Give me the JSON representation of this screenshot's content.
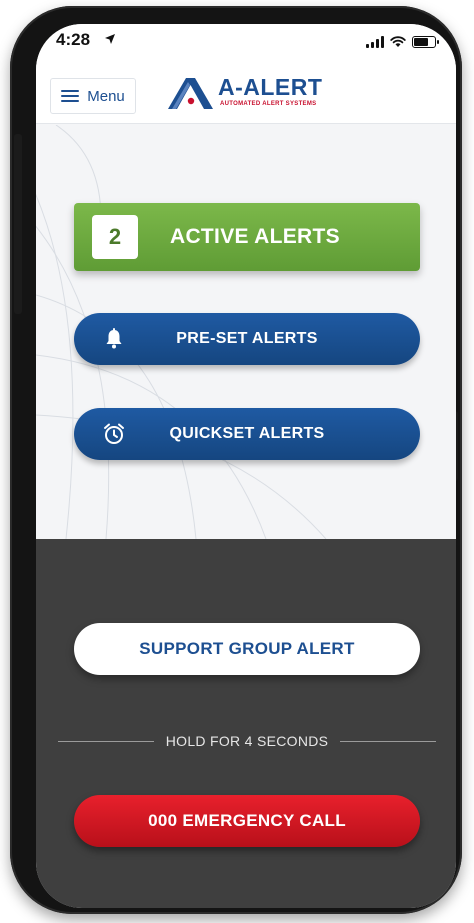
{
  "status_bar": {
    "time": "4:28"
  },
  "header": {
    "menu_label": "Menu",
    "logo_title": "A-ALERT",
    "logo_subtitle": "AUTOMATED ALERT SYSTEMS"
  },
  "active_alerts": {
    "count": "2",
    "label": "ACTIVE ALERTS"
  },
  "preset_alerts": {
    "label": "PRE-SET ALERTS",
    "icon": "bell-icon"
  },
  "quickset_alerts": {
    "label": "QUICKSET ALERTS",
    "icon": "alarm-clock-icon"
  },
  "support": {
    "label": "SUPPORT GROUP ALERT"
  },
  "hold_hint": "HOLD FOR 4 SECONDS",
  "emergency": {
    "label": "000 EMERGENCY CALL"
  },
  "colors": {
    "brand_blue": "#1d4f91",
    "active_green": "#6aa83c",
    "emergency_red": "#d8161f",
    "dark_panel": "#3f3f3f"
  }
}
